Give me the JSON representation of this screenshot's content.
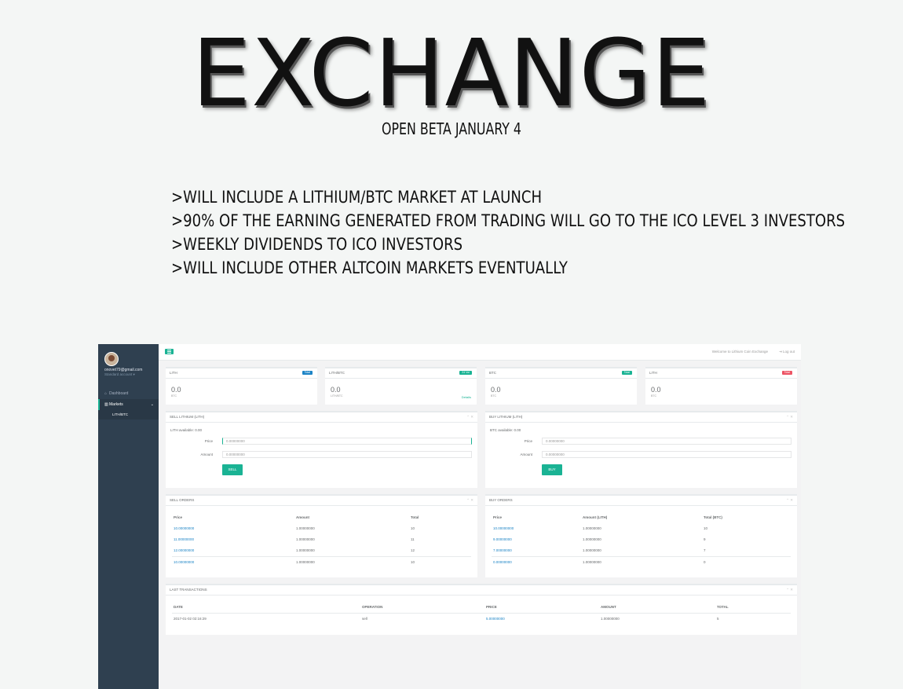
{
  "poster": {
    "title": "EXCHANGE",
    "subtitle": "OPEN BETA JANUARY 4",
    "features": [
      ">WILL INCLUDE A LITHIUM/BTC MARKET AT LAUNCH",
      ">90% OF THE EARNING GENERATED FROM TRADING WILL GO TO THE ICO LEVEL 3 INVESTORS",
      ">WEEKLY DIVIDENDS TO ICO INVESTORS",
      ">WILL INCLUDE OTHER ALTCOIN MARKETS EVENTUALLY"
    ]
  },
  "sidebar": {
    "email": "onovet79@gmail.com",
    "account": "Standard account",
    "items": [
      {
        "label": "Dashboard",
        "icon": "dashboard-icon"
      },
      {
        "label": "Markets",
        "icon": "bar-chart-icon"
      }
    ],
    "subitem": "LITH/BTC"
  },
  "topbar": {
    "welcome": "Welcome to Lithium Coin Exchange",
    "logout": "Log out"
  },
  "stats": [
    {
      "title": "LITH",
      "badge": "Total",
      "badge_color": "#1c84c6",
      "value": "0.0",
      "unit": "BTC",
      "link": ""
    },
    {
      "title": "LITH/BTC",
      "badge": "24 Vol",
      "badge_color": "#1ab394",
      "value": "0.0",
      "unit": "LITH/BTC",
      "link": "Details"
    },
    {
      "title": "BTC",
      "badge": "Total",
      "badge_color": "#1ab394",
      "value": "0.0",
      "unit": "BTC",
      "link": ""
    },
    {
      "title": "LITH",
      "badge": "Total",
      "badge_color": "#ed5565",
      "value": "0.0",
      "unit": "BTC",
      "link": ""
    }
  ],
  "sell_form": {
    "title": "SELL LITHIUM (LITH)",
    "available": "LITH available: 0.00",
    "price_label": "Price",
    "price_value": "0.00000000",
    "amount_label": "Amount",
    "amount_value": "0.00000000",
    "button": "SELL"
  },
  "buy_form": {
    "title": "BUY LITHIUM (LITH)",
    "available": "BTC available: 0.00",
    "price_label": "Price",
    "price_value": "0.00000000",
    "amount_label": "Amount",
    "amount_value": "0.00000000",
    "button": "BUY"
  },
  "sell_orders": {
    "title": "SELL ORDERS",
    "columns": [
      "Price",
      "Amount",
      "Total"
    ],
    "rows": [
      [
        "10.00000000",
        "1.00000000",
        "10"
      ],
      [
        "11.00000000",
        "1.00000000",
        "11"
      ],
      [
        "12.00000000",
        "1.00000000",
        "12"
      ],
      [
        "10.00000000",
        "1.00000000",
        "10"
      ]
    ]
  },
  "buy_orders": {
    "title": "BUY ORDERS",
    "columns": [
      "Price",
      "Amount (LITH)",
      "Total (BTC)"
    ],
    "rows": [
      [
        "10.00000000",
        "1.00000000",
        "10"
      ],
      [
        "9.00000000",
        "1.00000000",
        "9"
      ],
      [
        "7.00000000",
        "1.00000000",
        "7"
      ],
      [
        "0.00000000",
        "1.00000000",
        "0"
      ]
    ]
  },
  "transactions": {
    "title": "LAST TRANSACTIONS",
    "columns": [
      "DATE",
      "OPERATION",
      "PRICE",
      "AMOUNT",
      "TOTAL"
    ],
    "rows": [
      [
        "2017-01-02 02:16:29",
        "sell",
        "5.00000000",
        "1.00000000",
        "5"
      ]
    ]
  }
}
